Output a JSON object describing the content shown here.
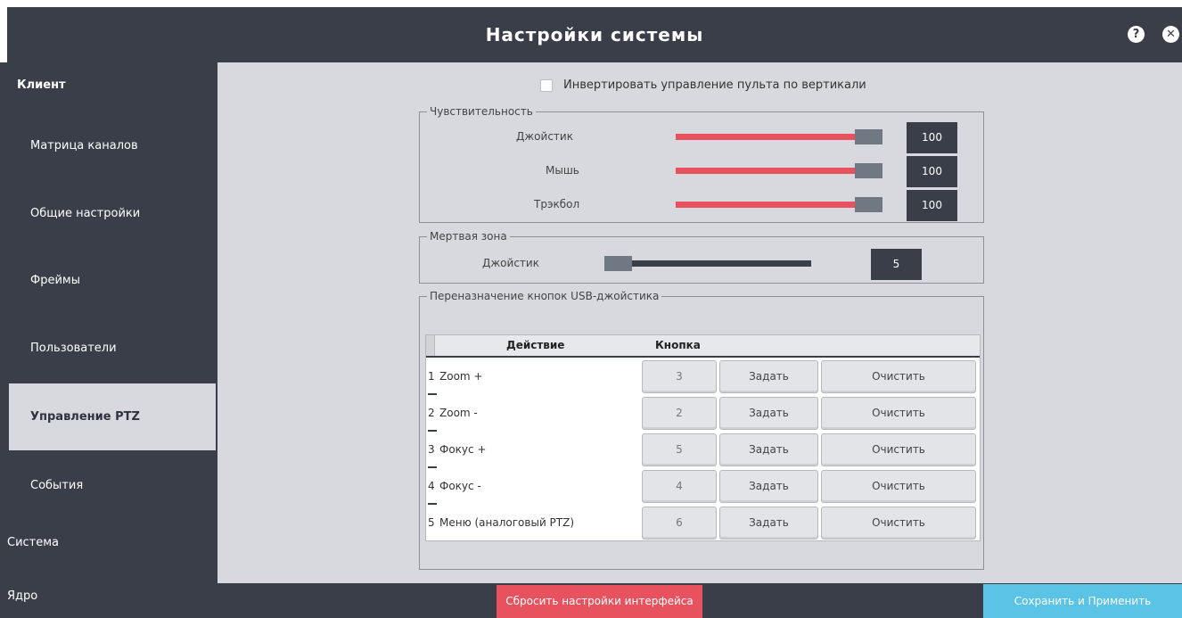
{
  "header": {
    "title": "Настройки системы",
    "help_icon": "question-circle-icon",
    "close_icon": "close-circle-icon"
  },
  "sidebar": {
    "client": "Клиент",
    "items": [
      "Матрица каналов",
      "Общие настройки",
      "Фреймы",
      "Пользователи",
      "Управление PTZ",
      "События"
    ],
    "active": "Управление PTZ",
    "system": "Система",
    "core": "Ядро"
  },
  "main": {
    "invert_label": "Инвертировать управление пульта по вертикали",
    "invert_checked": false,
    "sensitivity": {
      "legend": "Чувствительность",
      "rows": [
        {
          "label": "Джойстик",
          "value": "100",
          "fraction": 1.0
        },
        {
          "label": "Мышь",
          "value": "100",
          "fraction": 1.0
        },
        {
          "label": "Трэкбол",
          "value": "100",
          "fraction": 1.0
        }
      ]
    },
    "deadzone": {
      "legend": "Мертвая зона",
      "row": {
        "label": "Джойстик",
        "value": "5",
        "fraction": 0.0
      }
    },
    "remap": {
      "legend": "Переназначение кнопок USB-джойстика",
      "col_action": "Действие",
      "col_button": "Кнопка",
      "set_label": "Задать",
      "clear_label": "Очистить",
      "rows": [
        {
          "num": "1",
          "action": "Zoom +",
          "button": "3"
        },
        {
          "num": "2",
          "action": "Zoom -",
          "button": "2"
        },
        {
          "num": "3",
          "action": "Фокус +",
          "button": "5"
        },
        {
          "num": "4",
          "action": "Фокус -",
          "button": "4"
        },
        {
          "num": "5",
          "action": "Меню (аналоговый PTZ)",
          "button": "6"
        }
      ]
    }
  },
  "footer": {
    "reset_label": "Сбросить настройки интерфейса",
    "save_label": "Сохранить и Применить"
  },
  "colors": {
    "dark": "#3a3e49",
    "panel": "#d8d9de",
    "accent_red": "#e8525f",
    "accent_blue": "#5bc3e6",
    "handle": "#707884"
  }
}
